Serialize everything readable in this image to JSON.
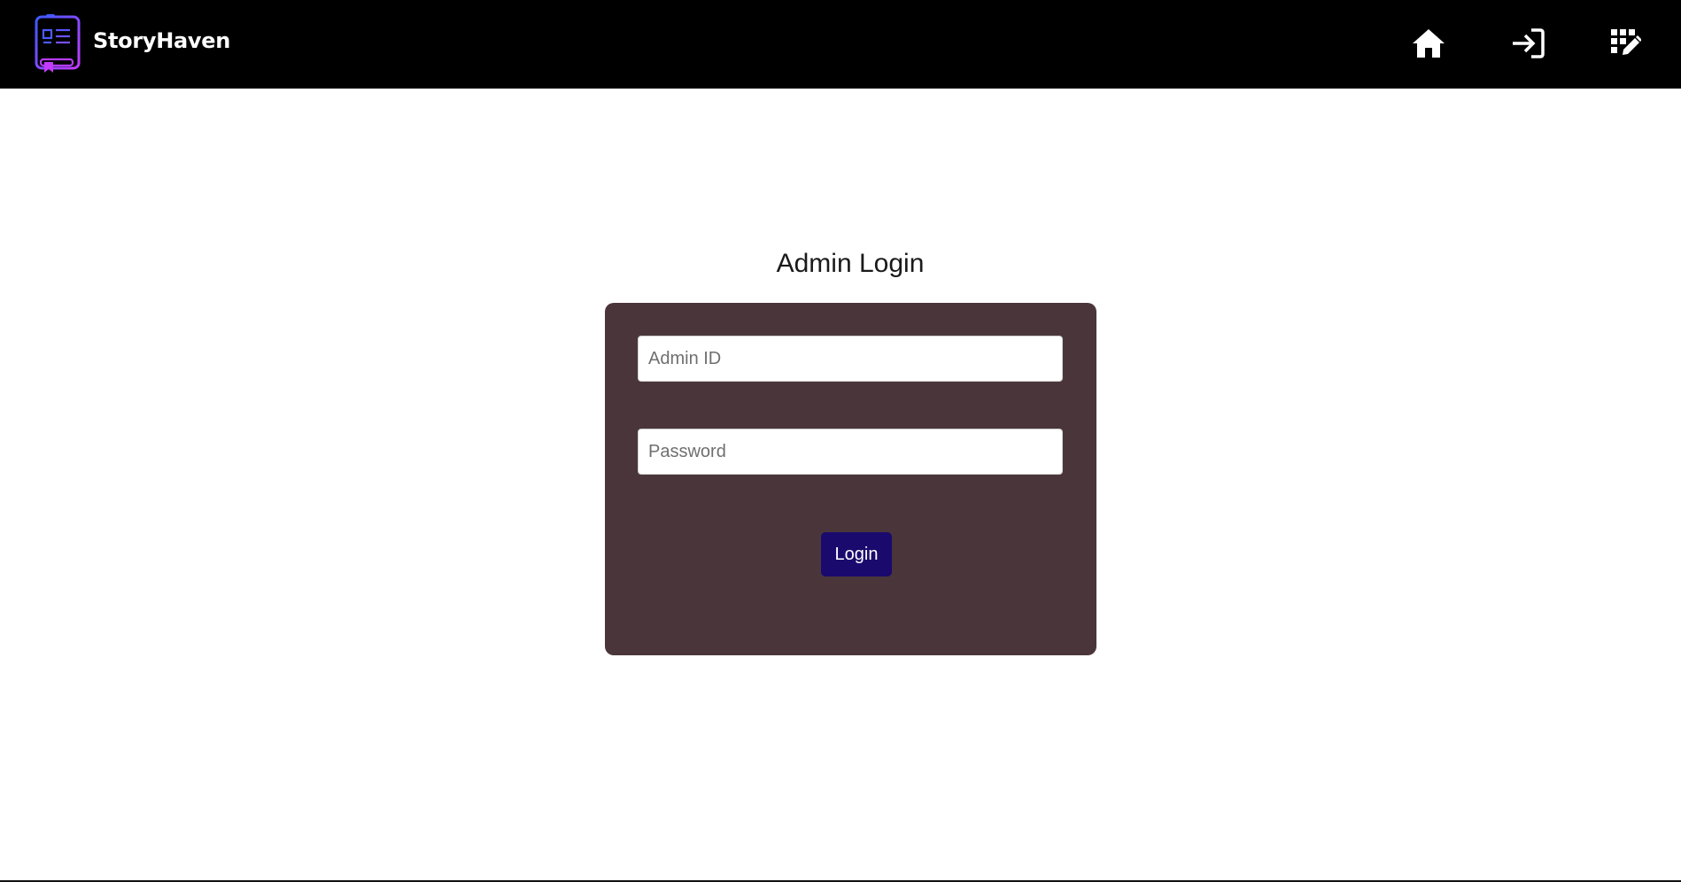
{
  "navbar": {
    "brand": "StoryHaven",
    "logo_icon": "book-list-icon",
    "items": [
      {
        "icon": "home-icon",
        "label": "Home"
      },
      {
        "icon": "sign-in-icon",
        "label": "Login"
      },
      {
        "icon": "edit-grid-icon",
        "label": "Register"
      }
    ]
  },
  "main": {
    "title": "Admin Login",
    "form": {
      "admin_id_placeholder": "Admin ID",
      "admin_id_value": "",
      "password_placeholder": "Password",
      "password_value": "",
      "submit_label": "Login"
    }
  },
  "colors": {
    "navbar_bg": "#000000",
    "card_bg": "#4a363a",
    "button_bg": "#1a0a6e",
    "logo_gradient_start": "#3b5bff",
    "logo_gradient_end": "#c23bff"
  }
}
